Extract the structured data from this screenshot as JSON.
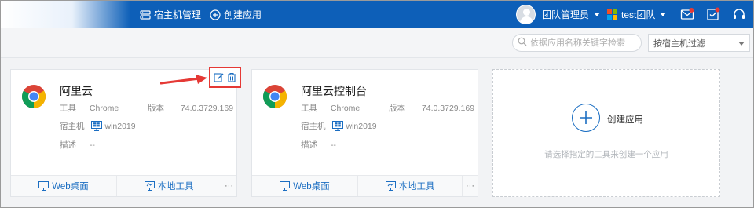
{
  "topbar": {
    "nav": [
      {
        "label": "宿主机管理",
        "icon": "server-icon"
      },
      {
        "label": "创建应用",
        "icon": "plus-circle-icon"
      }
    ],
    "user": {
      "name": "团队管理员"
    },
    "team": {
      "name": "test团队"
    },
    "icons": [
      "mail-icon",
      "task-check-icon",
      "headset-icon"
    ]
  },
  "filter": {
    "search_placeholder": "依据应用名称关键字检索",
    "host_filter_label": "按宿主机过滤"
  },
  "apps": [
    {
      "name": "阿里云",
      "tool_label": "工具",
      "tool_value": "Chrome",
      "version_label": "版本",
      "version_value": "74.0.3729.169",
      "host_label": "宿主机",
      "host_value": "win2019",
      "desc_label": "描述",
      "desc_value": "--",
      "web_label": "Web桌面",
      "local_label": "本地工具",
      "more_label": "···"
    },
    {
      "name": "阿里云控制台",
      "tool_label": "工具",
      "tool_value": "Chrome",
      "version_label": "版本",
      "version_value": "74.0.3729.169",
      "host_label": "宿主机",
      "host_value": "win2019",
      "desc_label": "描述",
      "desc_value": "--",
      "web_label": "Web桌面",
      "local_label": "本地工具",
      "more_label": "···"
    }
  ],
  "create": {
    "label": "创建应用",
    "hint": "请选择指定的工具来创建一个应用"
  },
  "colors": {
    "topbar": "#0d5fb8",
    "accent": "#1b6ec2",
    "highlight": "#e53935"
  }
}
